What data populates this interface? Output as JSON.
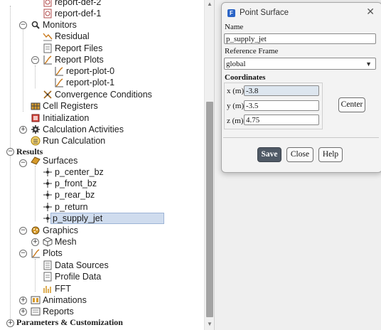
{
  "tree": {
    "items": [
      {
        "label": "report-def-2",
        "icon": "report-def-icon"
      },
      {
        "label": "report-def-1",
        "icon": "report-def-icon"
      },
      {
        "label": "Monitors",
        "icon": "monitors-icon",
        "toggle": "−"
      },
      {
        "label": "Residual",
        "icon": "residual-icon"
      },
      {
        "label": "Report Files",
        "icon": "report-files-icon"
      },
      {
        "label": "Report Plots",
        "icon": "report-plots-icon",
        "toggle": "−"
      },
      {
        "label": "report-plot-0",
        "icon": "report-plot-icon"
      },
      {
        "label": "report-plot-1",
        "icon": "report-plot-icon"
      },
      {
        "label": "Convergence Conditions",
        "icon": "convergence-icon"
      },
      {
        "label": "Cell Registers",
        "icon": "cell-registers-icon"
      },
      {
        "label": "Initialization",
        "icon": "initialization-icon"
      },
      {
        "label": "Calculation Activities",
        "icon": "calculation-activities-icon",
        "toggle": "+"
      },
      {
        "label": "Run Calculation",
        "icon": "run-calculation-icon"
      },
      {
        "label": "Results",
        "toggle": "−"
      },
      {
        "label": "Surfaces",
        "icon": "surfaces-icon",
        "toggle": "−"
      },
      {
        "label": "p_center_bz",
        "icon": "point-surface-icon"
      },
      {
        "label": "p_front_bz",
        "icon": "point-surface-icon"
      },
      {
        "label": "p_rear_bz",
        "icon": "point-surface-icon"
      },
      {
        "label": "p_return",
        "icon": "point-surface-icon"
      },
      {
        "label": "p_supply_jet",
        "icon": "point-surface-icon"
      },
      {
        "label": "Graphics",
        "icon": "graphics-icon",
        "toggle": "−"
      },
      {
        "label": "Mesh",
        "icon": "mesh-icon",
        "toggle": "+"
      },
      {
        "label": "Plots",
        "icon": "plots-icon",
        "toggle": "−"
      },
      {
        "label": "Data Sources",
        "icon": "data-sources-icon"
      },
      {
        "label": "Profile Data",
        "icon": "profile-data-icon"
      },
      {
        "label": "FFT",
        "icon": "fft-icon"
      },
      {
        "label": "Animations",
        "icon": "animations-icon",
        "toggle": "+"
      },
      {
        "label": "Reports",
        "icon": "reports-icon",
        "toggle": "+"
      },
      {
        "label": "Parameters & Customization",
        "toggle": "+"
      }
    ]
  },
  "dialog": {
    "title": "Point Surface",
    "name_label": "Name",
    "name_value": "p_supply_jet",
    "frame_label": "Reference Frame",
    "frame_value": "global",
    "coords_label": "Coordinates",
    "x_label": "x (m)",
    "x_value": "-3.8",
    "y_label": "y (m)",
    "y_value": "-3.5",
    "z_label": "z (m)",
    "z_value": "4.75",
    "center_label": "Center",
    "save_label": "Save",
    "close_label": "Close",
    "help_label": "Help"
  },
  "colors": {
    "selection": "#cfdcee",
    "primary_button": "#4f5965",
    "plot_icon": "#c9791b",
    "surface_icon": "#d69a2b"
  }
}
